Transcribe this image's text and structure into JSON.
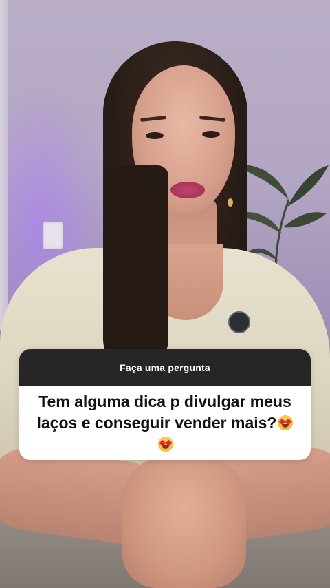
{
  "question_box": {
    "header": "Faça uma pergunta",
    "question_text": "Tem alguma dica p divulgar meus laços e conseguir vender mais?",
    "emojis": [
      "heart-eyes-emoji",
      "heart-eyes-emoji"
    ]
  },
  "colors": {
    "header_bg": "#262626",
    "header_text": "#ffffff",
    "body_bg": "#ffffff",
    "body_text": "#111111"
  }
}
